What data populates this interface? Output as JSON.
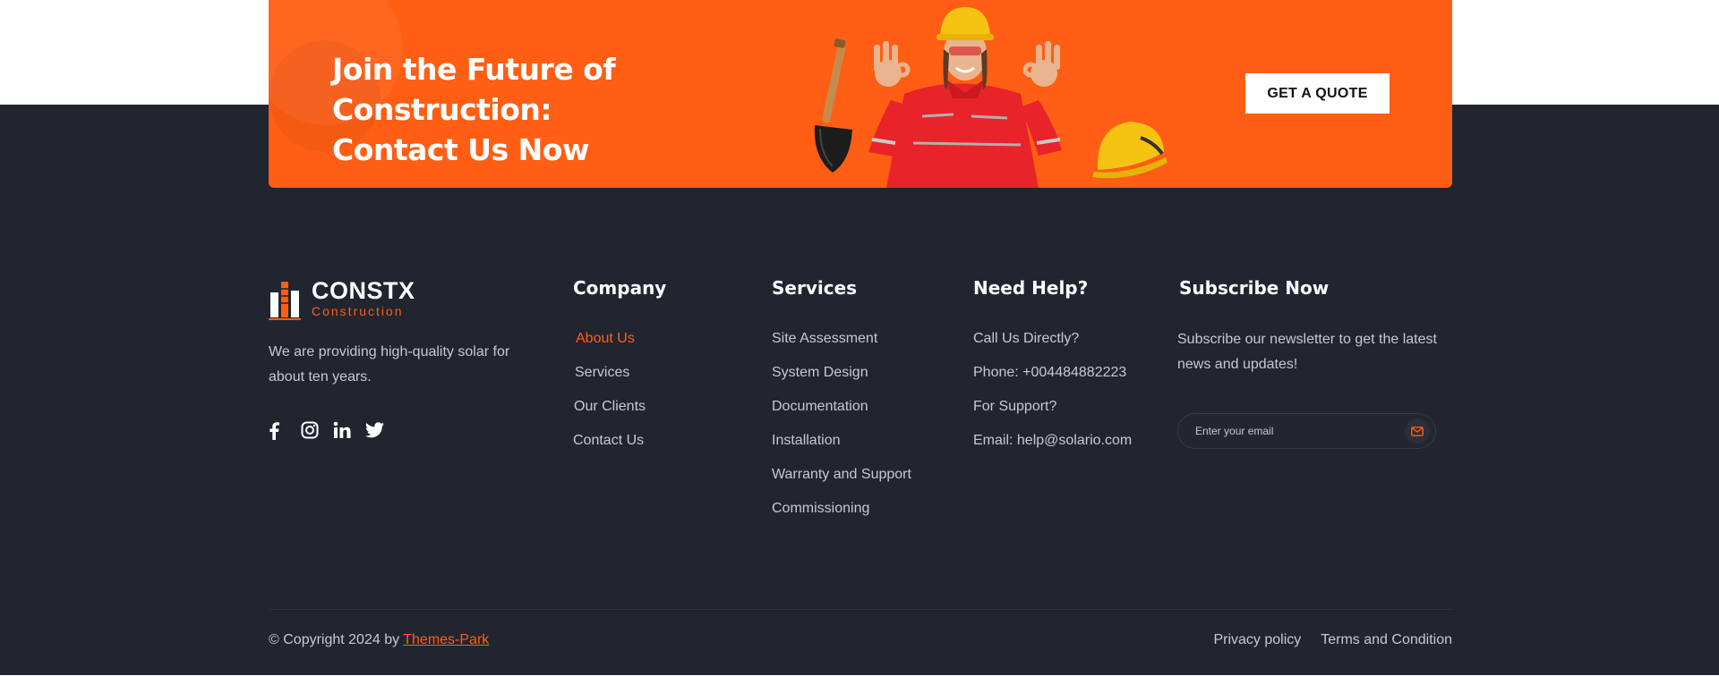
{
  "cta": {
    "title_line1": "Join the Future of Construction:",
    "title_line2": "Contact Us Now",
    "button_label": "GET A QUOTE"
  },
  "brand": {
    "name": "CONSTX",
    "tagline": "Construction",
    "description": "We are providing high-quality solar for about ten years.",
    "accent_color": "#ff5e14",
    "social_icons": [
      "facebook-icon",
      "instagram-icon",
      "linkedin-icon",
      "twitter-icon"
    ]
  },
  "company": {
    "title": "Company",
    "items": [
      "About Us",
      "Services",
      "Our Clients",
      "Contact Us"
    ]
  },
  "services": {
    "title": "Services",
    "items": [
      "Site Assessment",
      "System Design",
      "Documentation",
      "Installation",
      "Warranty and Support",
      "Commissioning"
    ]
  },
  "help": {
    "title": "Need Help?",
    "items": [
      "Call Us Directly?",
      "Phone: +004484882223",
      "For Support?",
      "Email: help@solario.com"
    ]
  },
  "subscribe": {
    "title": "Subscribe Now",
    "description": "Subscribe our newsletter to get the latest news and updates!",
    "placeholder": "Enter your email"
  },
  "bottom": {
    "copyright_prefix": "© Copyright 2024 by ",
    "copyright_link": "Themes-Park",
    "privacy": "Privacy policy",
    "terms": "Terms and Condition"
  }
}
